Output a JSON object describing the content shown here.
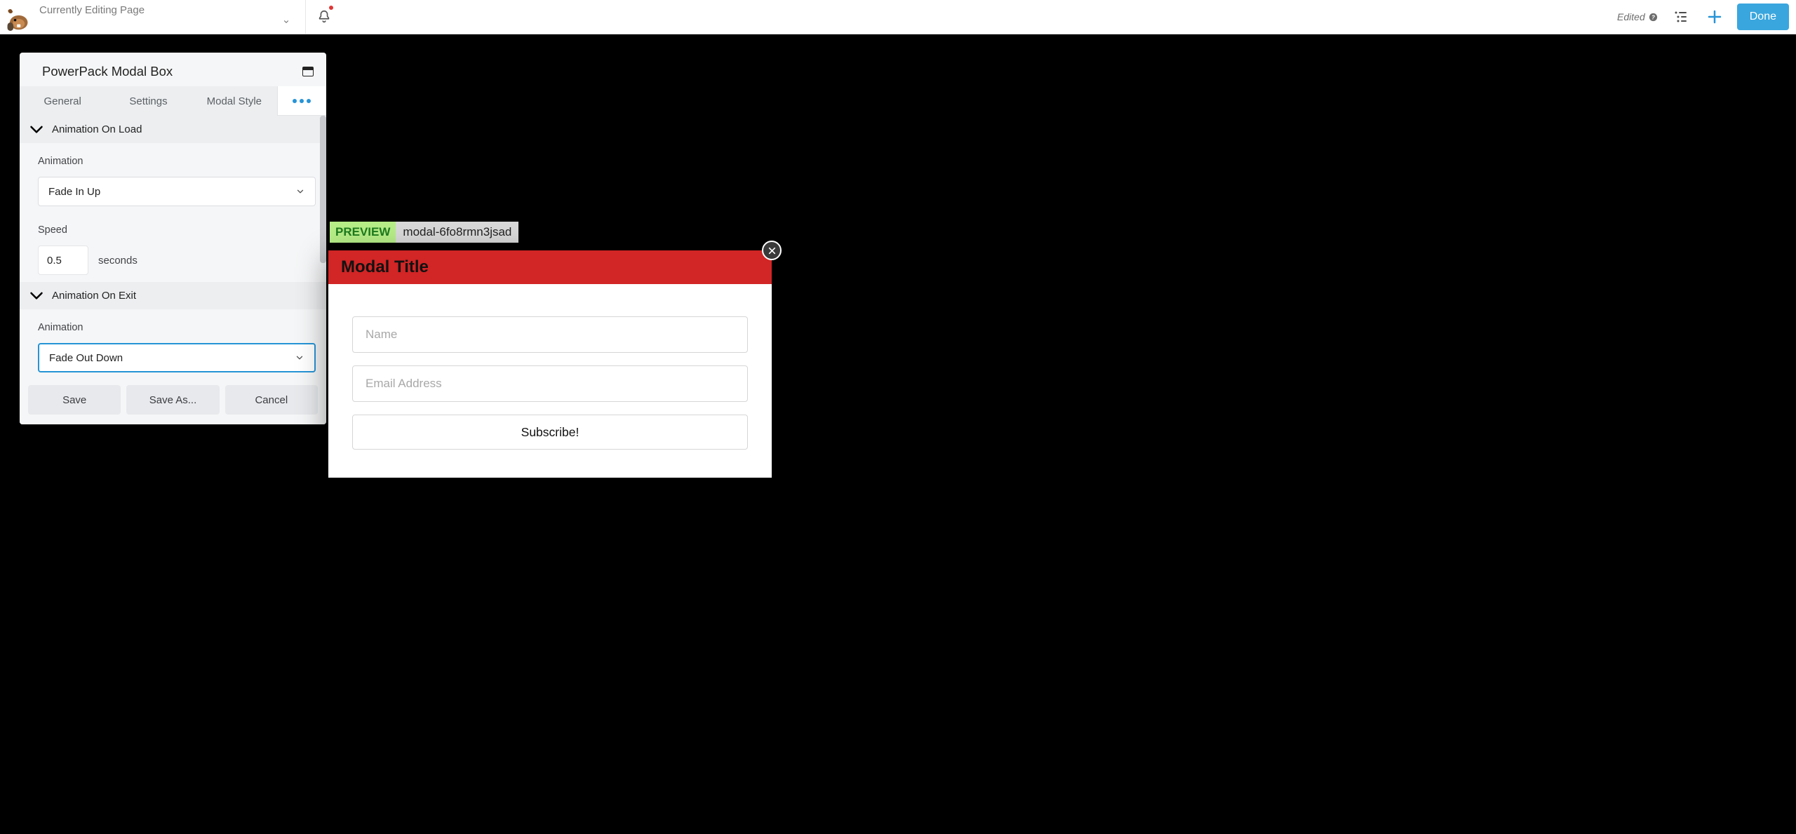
{
  "topbar": {
    "page_title": "Currently Editing Page",
    "edited_label": "Edited",
    "done_label": "Done"
  },
  "panel": {
    "title": "PowerPack Modal Box",
    "tabs": [
      "General",
      "Settings",
      "Modal Style"
    ],
    "sections": {
      "on_load": {
        "title": "Animation On Load",
        "animation_label": "Animation",
        "animation_value": "Fade In Up",
        "speed_label": "Speed",
        "speed_value": "0.5",
        "speed_unit": "seconds"
      },
      "on_exit": {
        "title": "Animation On Exit",
        "animation_label": "Animation",
        "animation_value": "Fade Out Down"
      }
    },
    "footer": {
      "save": "Save",
      "save_as": "Save As...",
      "cancel": "Cancel"
    }
  },
  "preview": {
    "label": "PREVIEW",
    "id": "modal-6fo8rmn3jsad"
  },
  "modal": {
    "title": "Modal Title",
    "name_placeholder": "Name",
    "email_placeholder": "Email Address",
    "submit_label": "Subscribe!"
  }
}
